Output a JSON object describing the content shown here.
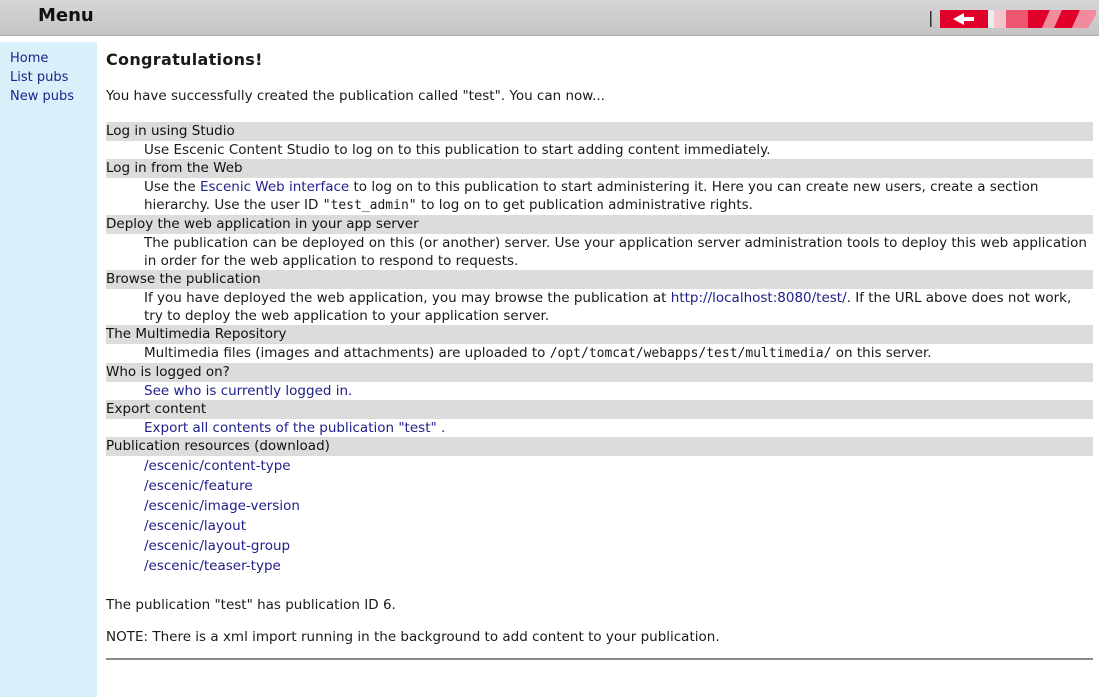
{
  "header": {
    "title": "Menu",
    "logo_icon": "escenic-logo-icon"
  },
  "sidebar": {
    "items": [
      {
        "label": "Home"
      },
      {
        "label": "List pubs"
      },
      {
        "label": "New pubs"
      }
    ]
  },
  "main": {
    "title": "Congratulations!",
    "intro": "You have successfully created the publication called \"test\". You can now...",
    "sections": {
      "studio": {
        "heading": "Log in using Studio",
        "text": "Use Escenic Content Studio to log on to this publication to start adding content immediately."
      },
      "web": {
        "heading": "Log in from the Web",
        "text_before": "Use the ",
        "link": "Escenic Web interface",
        "text_after": " to log on to this publication to start administering it. Here you can create new users, create a section hierarchy. Use the user ID ",
        "user_id": "\"test_admin\"",
        "text_end": " to log on to get publication administrative rights."
      },
      "deploy": {
        "heading": "Deploy the web application in your app server",
        "text": "The publication can be deployed on this (or another) server. Use your application server administration tools to deploy this web application in order for the web application to respond to requests."
      },
      "browse": {
        "heading": "Browse the publication",
        "text_before": "If you have deployed the web application, you may browse the publication at ",
        "link": "http://localhost:8080/test/",
        "text_after": ". If the URL above does not work, try to deploy the web application to your application server."
      },
      "multimedia": {
        "heading": "The Multimedia Repository",
        "text_before": "Multimedia files (images and attachments) are uploaded to ",
        "path": "/opt/tomcat/webapps/test/multimedia/",
        "text_after": " on this server."
      },
      "logged": {
        "heading": "Who is logged on?",
        "link": "See who is currently logged in."
      },
      "export": {
        "heading": "Export content",
        "link": "Export all contents of the publication \"test\" ."
      },
      "resources": {
        "heading": "Publication resources (download)",
        "items": [
          "/escenic/content-type",
          "/escenic/feature",
          "/escenic/image-version",
          "/escenic/layout",
          "/escenic/layout-group",
          "/escenic/teaser-type"
        ]
      }
    },
    "pub_id_text": "The publication \"test\" has publication ID 6.",
    "note": "NOTE: There is a xml import running in the background to add content to your publication."
  }
}
